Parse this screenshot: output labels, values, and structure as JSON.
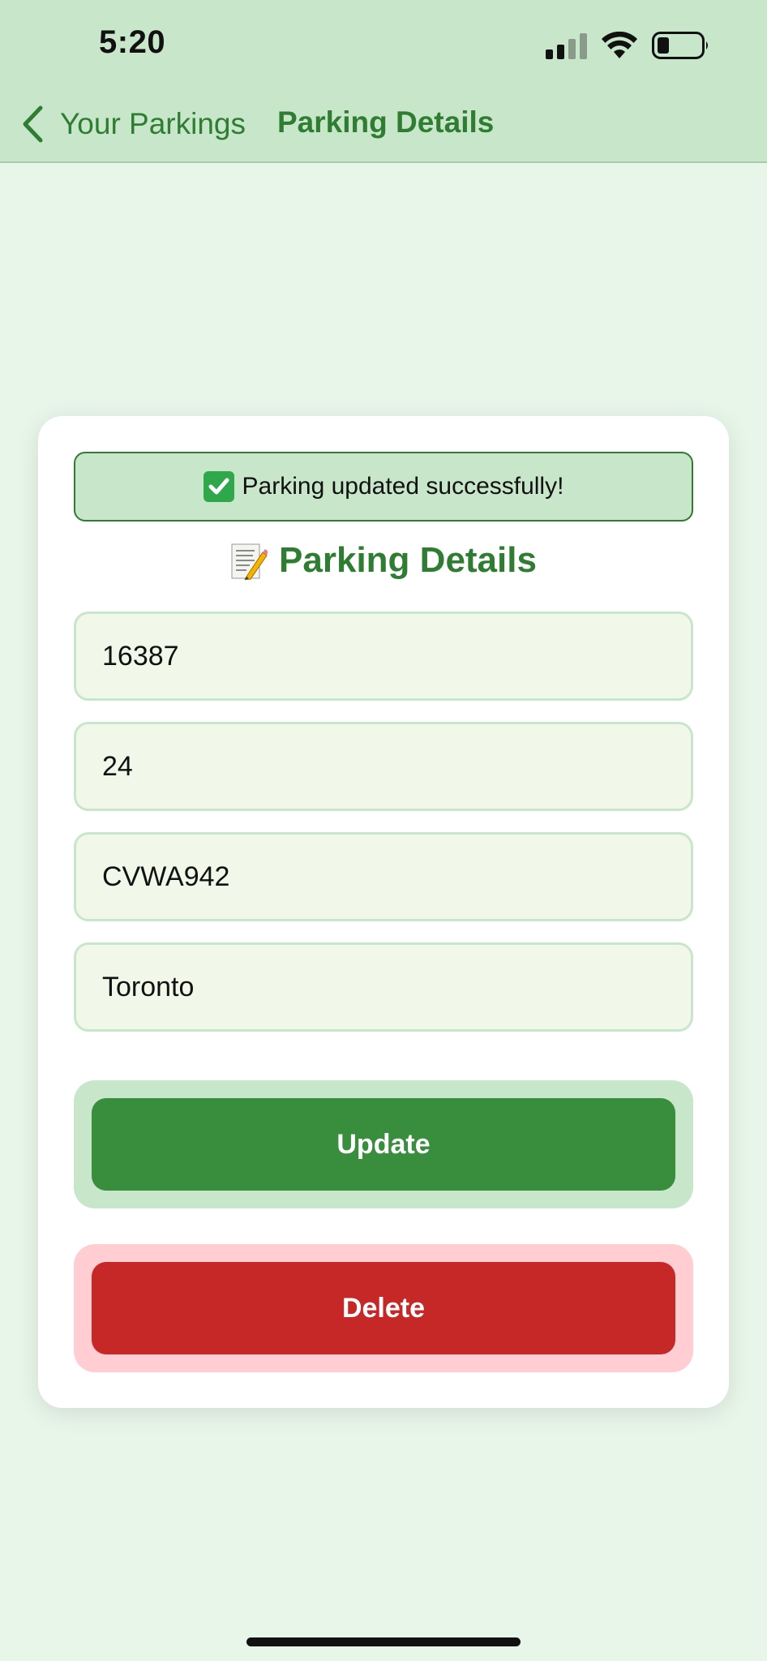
{
  "status_bar": {
    "time": "5:20"
  },
  "nav": {
    "back_label": "Your Parkings",
    "title": "Parking Details"
  },
  "toast": {
    "message": "Parking updated successfully!"
  },
  "card": {
    "title": "Parking Details"
  },
  "fields": {
    "building_code": "16387",
    "hours": "24",
    "license_plate": "CVWA942",
    "city": "Toronto"
  },
  "buttons": {
    "update": "Update",
    "delete": "Delete"
  },
  "colors": {
    "header_bg": "#c8e6c9",
    "page_bg": "#e8f5e9",
    "accent_green": "#2e7d32",
    "update_button": "#388e3c",
    "delete_button": "#c62828"
  }
}
